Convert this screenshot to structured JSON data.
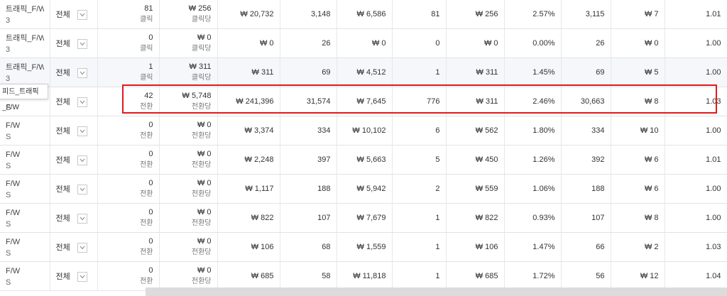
{
  "tooltip": "피드_트래픽_F/W",
  "highlight_color": "#e0191f",
  "rows": [
    {
      "name_l1": "트래픽_F/W",
      "name_l2": "3",
      "target": "전체",
      "bid_a": "81",
      "bid_a_unit": "클릭",
      "bid_b": "₩ 256",
      "bid_b_unit": "클릭당",
      "c1": "₩ 20,732",
      "c2": "3,148",
      "c3": "₩ 6,586",
      "c4": "81",
      "c5": "₩ 256",
      "c6": "2.57%",
      "c7": "3,115",
      "c8": "₩ 7",
      "c9": "1.01"
    },
    {
      "name_l1": "트래픽_F/W",
      "name_l2": "3",
      "target": "전체",
      "bid_a": "0",
      "bid_a_unit": "클릭",
      "bid_b": "₩ 0",
      "bid_b_unit": "클릭당",
      "c1": "₩ 0",
      "c2": "26",
      "c3": "₩ 0",
      "c4": "0",
      "c5": "₩ 0",
      "c6": "0.00%",
      "c7": "26",
      "c8": "₩ 0",
      "c9": "1.00"
    },
    {
      "name_l1": "트래픽_F/W",
      "name_l2": "3",
      "target": "전체",
      "bid_a": "1",
      "bid_a_unit": "클릭",
      "bid_b": "₩ 311",
      "bid_b_unit": "클릭당",
      "c1": "₩ 311",
      "c2": "69",
      "c3": "₩ 4,512",
      "c4": "1",
      "c5": "₩ 311",
      "c6": "1.45%",
      "c7": "69",
      "c8": "₩ 5",
      "c9": "1.00"
    },
    {
      "name_l1": "",
      "name_l2": "S",
      "target": "전체",
      "bid_a": "42",
      "bid_a_unit": "전환",
      "bid_b": "₩ 5,748",
      "bid_b_unit": "전환당",
      "c1": "₩ 241,396",
      "c2": "31,574",
      "c3": "₩ 7,645",
      "c4": "776",
      "c5": "₩ 311",
      "c6": "2.46%",
      "c7": "30,663",
      "c8": "₩ 8",
      "c9": "1.03"
    },
    {
      "name_l1": "F/W",
      "name_l2": "S",
      "target": "전체",
      "bid_a": "0",
      "bid_a_unit": "전환",
      "bid_b": "₩ 0",
      "bid_b_unit": "전환당",
      "c1": "₩ 3,374",
      "c2": "334",
      "c3": "₩ 10,102",
      "c4": "6",
      "c5": "₩ 562",
      "c6": "1.80%",
      "c7": "334",
      "c8": "₩ 10",
      "c9": "1.00"
    },
    {
      "name_l1": "F/W",
      "name_l2": "S",
      "target": "전체",
      "bid_a": "0",
      "bid_a_unit": "전환",
      "bid_b": "₩ 0",
      "bid_b_unit": "전환당",
      "c1": "₩ 2,248",
      "c2": "397",
      "c3": "₩ 5,663",
      "c4": "5",
      "c5": "₩ 450",
      "c6": "1.26%",
      "c7": "392",
      "c8": "₩ 6",
      "c9": "1.01"
    },
    {
      "name_l1": "F/W",
      "name_l2": "S",
      "target": "전체",
      "bid_a": "0",
      "bid_a_unit": "전환",
      "bid_b": "₩ 0",
      "bid_b_unit": "전환당",
      "c1": "₩ 1,117",
      "c2": "188",
      "c3": "₩ 5,942",
      "c4": "2",
      "c5": "₩ 559",
      "c6": "1.06%",
      "c7": "188",
      "c8": "₩ 6",
      "c9": "1.00"
    },
    {
      "name_l1": "F/W",
      "name_l2": "S",
      "target": "전체",
      "bid_a": "0",
      "bid_a_unit": "전환",
      "bid_b": "₩ 0",
      "bid_b_unit": "전환당",
      "c1": "₩ 822",
      "c2": "107",
      "c3": "₩ 7,679",
      "c4": "1",
      "c5": "₩ 822",
      "c6": "0.93%",
      "c7": "107",
      "c8": "₩ 8",
      "c9": "1.00"
    },
    {
      "name_l1": "F/W",
      "name_l2": "S",
      "target": "전체",
      "bid_a": "0",
      "bid_a_unit": "전환",
      "bid_b": "₩ 0",
      "bid_b_unit": "전환당",
      "c1": "₩ 106",
      "c2": "68",
      "c3": "₩ 1,559",
      "c4": "1",
      "c5": "₩ 106",
      "c6": "1.47%",
      "c7": "66",
      "c8": "₩ 2",
      "c9": "1.03"
    },
    {
      "name_l1": "F/W",
      "name_l2": "S",
      "target": "전체",
      "bid_a": "0",
      "bid_a_unit": "전환",
      "bid_b": "₩ 0",
      "bid_b_unit": "전환당",
      "c1": "₩ 685",
      "c2": "58",
      "c3": "₩ 11,818",
      "c4": "1",
      "c5": "₩ 685",
      "c6": "1.72%",
      "c7": "56",
      "c8": "₩ 12",
      "c9": "1.04"
    }
  ]
}
